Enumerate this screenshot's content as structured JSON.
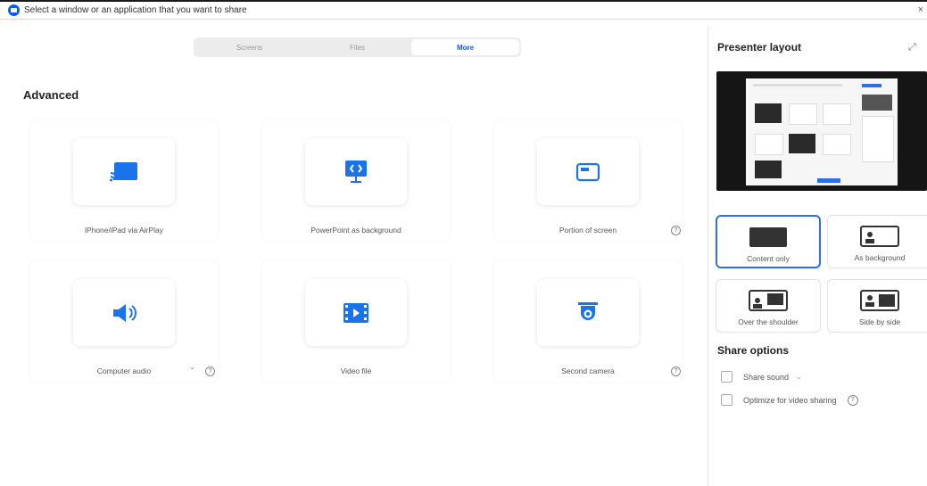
{
  "titlebar": {
    "prompt": "Select a window or an application that you want to share",
    "close_glyph": "×"
  },
  "tabs": [
    {
      "label": "Screens",
      "active": false
    },
    {
      "label": "Files",
      "active": false
    },
    {
      "label": "More",
      "active": true
    }
  ],
  "main": {
    "section_heading": "Advanced",
    "cards": [
      {
        "label": "iPhone/iPad via AirPlay",
        "icon": "airplay-icon"
      },
      {
        "label": "PowerPoint as background",
        "icon": "powerpoint-background-icon"
      },
      {
        "label": "Portion of screen",
        "icon": "portion-of-screen-icon",
        "help": "?"
      },
      {
        "label": "Computer audio",
        "icon": "speaker-icon",
        "help": "?",
        "dropdown": "⌄"
      },
      {
        "label": "Video file",
        "icon": "video-file-icon"
      },
      {
        "label": "Second camera",
        "icon": "camera-icon",
        "help": "?"
      }
    ]
  },
  "panel": {
    "presenter_title": "Presenter layout",
    "expand_glyph": "⤢",
    "layouts": [
      {
        "label": "Content only",
        "selected": true
      },
      {
        "label": "As background",
        "selected": false
      },
      {
        "label": "Over the shoulder",
        "selected": false
      },
      {
        "label": "Side by side",
        "selected": false
      }
    ],
    "share_title": "Share options",
    "options": [
      {
        "label": "Share sound",
        "checked": false,
        "dropdown": "⌄"
      },
      {
        "label": "Optimize for video sharing",
        "checked": false,
        "help": "?"
      }
    ]
  },
  "colors": {
    "accent": "#0b5cff",
    "icon_blue": "#1a73e8",
    "selected_border": "#2d6fe8"
  }
}
